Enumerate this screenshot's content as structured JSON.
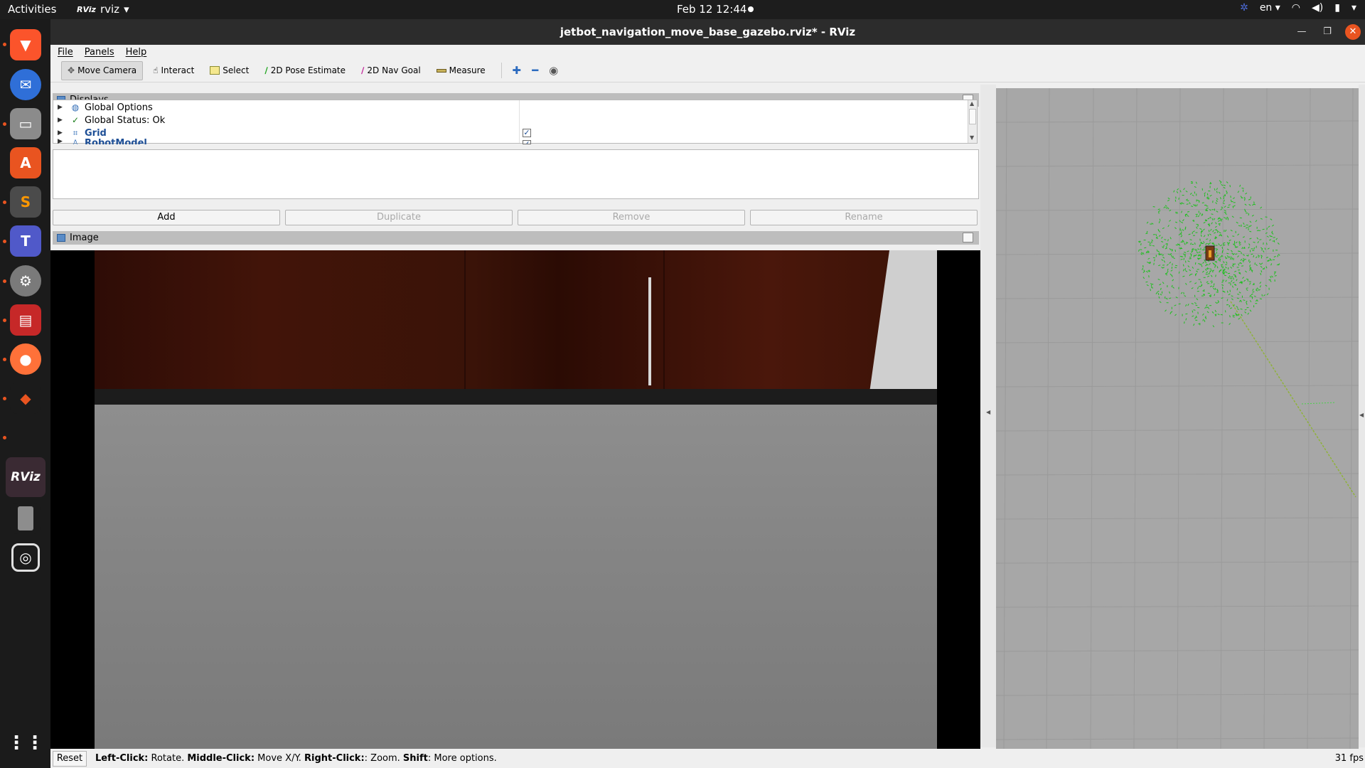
{
  "topbar": {
    "activities": "Activities",
    "app_name": "rviz",
    "app_icon_text": "RViz",
    "clock": "Feb 12  12:44",
    "language": "en"
  },
  "dock": {
    "items": [
      {
        "name": "brave-icon",
        "color": "#fb542b"
      },
      {
        "name": "thunderbird-icon",
        "color": "#2f6fd8"
      },
      {
        "name": "files-icon",
        "color": "#8b8b8b"
      },
      {
        "name": "app-center-icon",
        "color": "#e95420"
      },
      {
        "name": "sublime-text-icon",
        "color": "#4b4b4b"
      },
      {
        "name": "teams-icon",
        "color": "#5059c9"
      },
      {
        "name": "settings-icon",
        "color": "#7a7a7a"
      },
      {
        "name": "terminal-icon",
        "color": "#c62828"
      },
      {
        "name": "firefox-icon",
        "color": "#ff7139"
      },
      {
        "name": "sketch-tool-icon",
        "color": "#e95420"
      },
      {
        "name": "rviz-icon",
        "color": "#3a2a33"
      },
      {
        "name": "device-icon",
        "color": "#9a9a9a"
      },
      {
        "name": "screenshot-icon",
        "color": "#333333"
      },
      {
        "name": "show-apps-icon",
        "color": "#1b1b1b"
      }
    ]
  },
  "window": {
    "title": "jetbot_navigation_move_base_gazebo.rviz* - RViz"
  },
  "menu": {
    "file": "File",
    "panels": "Panels",
    "help": "Help"
  },
  "toolbar": {
    "move_camera": "Move Camera",
    "interact": "Interact",
    "select": "Select",
    "pose_estimate": "2D Pose Estimate",
    "nav_goal": "2D Nav Goal",
    "measure": "Measure"
  },
  "displays": {
    "header": "Displays",
    "rows": [
      {
        "label": "Global Options",
        "checked": null
      },
      {
        "label": "Global Status: Ok",
        "checked": null
      },
      {
        "label": "Grid",
        "checked": true
      },
      {
        "label": "RobotModel",
        "checked": true
      }
    ],
    "check_mark": "✓"
  },
  "buttons": {
    "add": "Add",
    "duplicate": "Duplicate",
    "remove": "Remove",
    "rename": "Rename"
  },
  "image_panel": {
    "header": "Image"
  },
  "status": {
    "reset": "Reset",
    "left_click_key": "Left-Click:",
    "left_click_desc": " Rotate. ",
    "middle_click_key": "Middle-Click:",
    "middle_click_desc": " Move X/Y. ",
    "right_click_key": "Right-Click:",
    "right_click_desc": ": Zoom. ",
    "shift_key": "Shift",
    "shift_desc": ": More options.",
    "fps": "31 fps"
  },
  "colors": {
    "accent": "#e95420",
    "particles": "#1fbf1f",
    "path": "#8fb23a"
  }
}
